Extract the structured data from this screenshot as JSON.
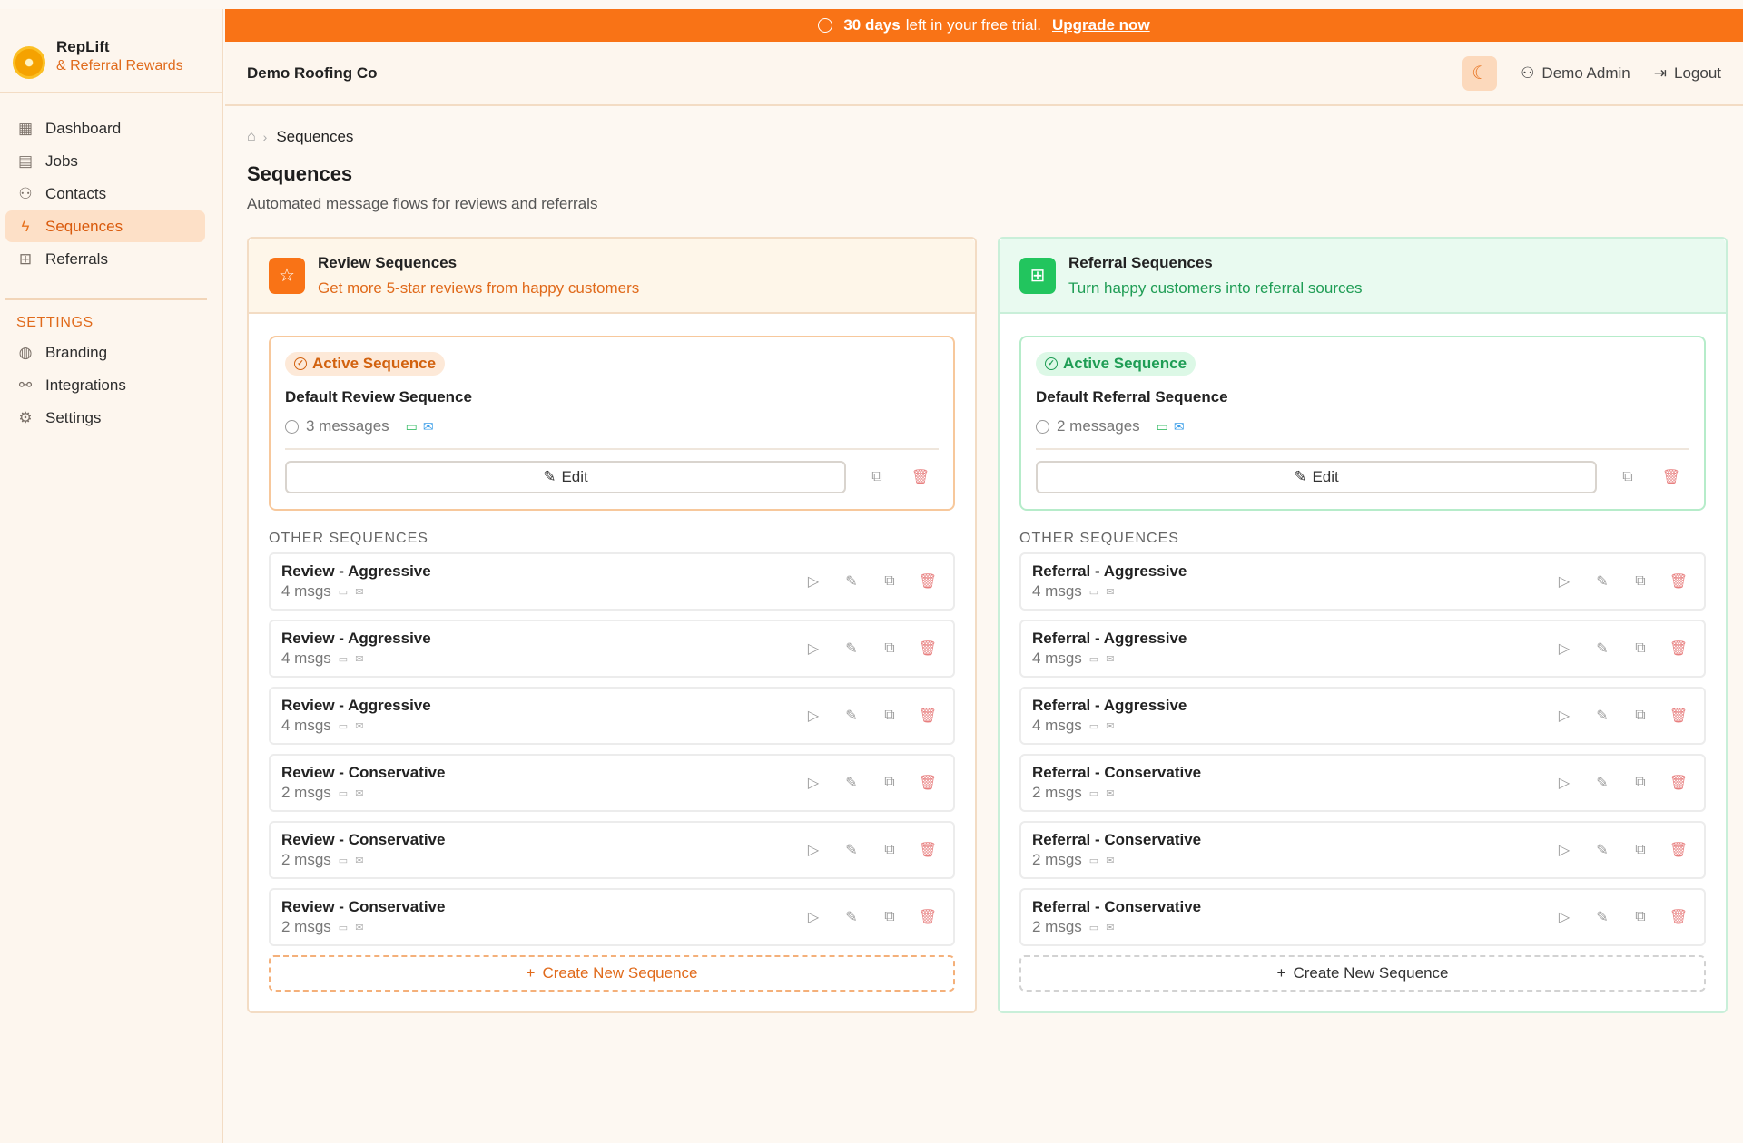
{
  "brand": {
    "name": "RepLift",
    "subtitle": "& Referral Rewards"
  },
  "sidebar": {
    "items": [
      {
        "label": "Dashboard",
        "icon": "grid-icon"
      },
      {
        "label": "Jobs",
        "icon": "briefcase-icon"
      },
      {
        "label": "Contacts",
        "icon": "users-icon"
      },
      {
        "label": "Sequences",
        "icon": "zap-icon",
        "active": true
      },
      {
        "label": "Referrals",
        "icon": "gift-icon"
      }
    ],
    "settings_heading": "SETTINGS",
    "settings_items": [
      {
        "label": "Branding",
        "icon": "palette-icon"
      },
      {
        "label": "Integrations",
        "icon": "link-icon"
      },
      {
        "label": "Settings",
        "icon": "gear-icon"
      }
    ]
  },
  "banner": {
    "days": "30 days",
    "text": "left in your free trial.",
    "link": "Upgrade now",
    "color": "#f97316"
  },
  "header": {
    "company": "Demo Roofing Co",
    "user": "Demo Admin",
    "logout": "Logout"
  },
  "breadcrumb": {
    "current": "Sequences"
  },
  "page": {
    "title": "Sequences",
    "subtitle": "Automated message flows for reviews and referrals"
  },
  "review": {
    "title": "Review Sequences",
    "subtitle": "Get more 5-star reviews from happy customers",
    "active_badge": "Active Sequence",
    "active_name": "Default Review Sequence",
    "active_meta": "3 messages",
    "edit_label": "Edit",
    "other_label": "OTHER SEQUENCES",
    "rows": [
      {
        "name": "Review - Aggressive",
        "meta": "4 msgs"
      },
      {
        "name": "Review - Aggressive",
        "meta": "4 msgs"
      },
      {
        "name": "Review - Aggressive",
        "meta": "4 msgs"
      },
      {
        "name": "Review - Conservative",
        "meta": "2 msgs"
      },
      {
        "name": "Review - Conservative",
        "meta": "2 msgs"
      },
      {
        "name": "Review - Conservative",
        "meta": "2 msgs"
      }
    ],
    "create_label": "Create New Sequence"
  },
  "referral": {
    "title": "Referral Sequences",
    "subtitle": "Turn happy customers into referral sources",
    "active_badge": "Active Sequence",
    "active_name": "Default Referral Sequence",
    "active_meta": "2 messages",
    "edit_label": "Edit",
    "other_label": "OTHER SEQUENCES",
    "rows": [
      {
        "name": "Referral - Aggressive",
        "meta": "4 msgs"
      },
      {
        "name": "Referral - Aggressive",
        "meta": "4 msgs"
      },
      {
        "name": "Referral - Aggressive",
        "meta": "4 msgs"
      },
      {
        "name": "Referral - Conservative",
        "meta": "2 msgs"
      },
      {
        "name": "Referral - Conservative",
        "meta": "2 msgs"
      },
      {
        "name": "Referral - Conservative",
        "meta": "2 msgs"
      }
    ],
    "create_label": "Create New Sequence"
  }
}
